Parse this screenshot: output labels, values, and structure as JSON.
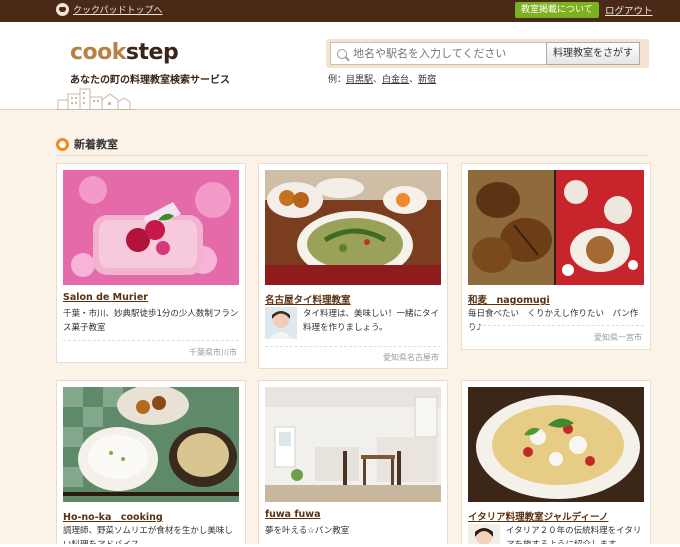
{
  "topbar": {
    "home_link": "クックパッドトップへ",
    "about_button": "教室掲載について",
    "logout_link": "ログアウト"
  },
  "header": {
    "logo_part1": "cook",
    "logo_part2": "step",
    "tagline": "あなたの町の料理教室検索サービス"
  },
  "search": {
    "placeholder": "地名や駅名を入力してください",
    "button_label": "料理教室をさがす",
    "examples_prefix": "例：",
    "examples": [
      "目黒駅",
      "白金台",
      "新宿"
    ],
    "separator": "、"
  },
  "section": {
    "title": "新着教室"
  },
  "cards": [
    {
      "title": "Salon de Murier",
      "desc": "千葉・市川、妙典駅徒歩1分の少人数制フランス菓子教室",
      "location": "千葉県市川市"
    },
    {
      "title": "名古屋タイ料理教室",
      "desc": "タイ料理は、美味しい！一緒にタイ料理を作りましょう。",
      "location": "愛知県名古屋市"
    },
    {
      "title": "和麦　nagomugi",
      "desc": "毎日食べたい　くりかえし作りたい　パン作り♪",
      "location": "愛知県一宮市"
    },
    {
      "title": "Ho-no-ka　cooking",
      "desc": "調理師、野菜ソムリエが食材を生かし美味しい料理をアドバイス",
      "location": ""
    },
    {
      "title": "fuwa fuwa",
      "desc": "夢を叶える☆パン教室",
      "location": ""
    },
    {
      "title": "イタリア料理教室ジャルディーノ",
      "desc": "イタリア２０年の伝統料理をイタリアを旅するように紹介します",
      "location": ""
    }
  ],
  "colors": {
    "topbar": "#4a2a17",
    "accent_green": "#7db21f",
    "accent_orange": "#f08a1d",
    "page_bg": "#fbf3e8",
    "title_brown": "#5a3212"
  }
}
